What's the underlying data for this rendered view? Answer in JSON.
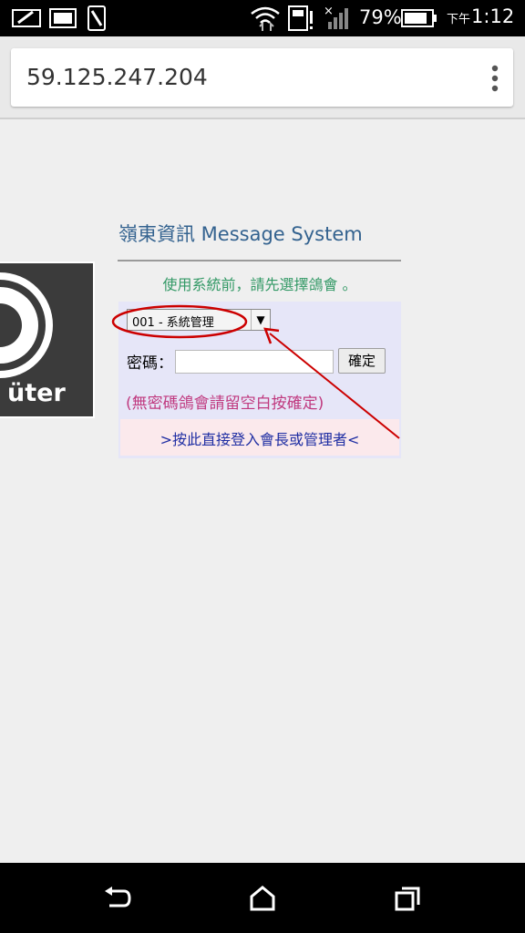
{
  "status_bar": {
    "battery_percent": "79%",
    "time_prefix": "下午",
    "time": "1:12"
  },
  "browser": {
    "url": "59.125.247.204",
    "menu_icon": "more-vert-icon"
  },
  "page": {
    "site_title": "嶺東資訊 Message System",
    "instruction": "使用系統前，請先選擇鴿會 。",
    "select": {
      "selected": "001 - 系統管理",
      "arrow": "▼"
    },
    "password_label": "密碼：",
    "password_value": "",
    "confirm_label": "確定",
    "hint": "(無密碼鴿會請留空白按確定)",
    "admin_link": ">按此直接登入會長或管理者<",
    "logo_text": "üter",
    "panel_color": "#e6e6f8",
    "link_box_color": "#fbe9ec",
    "annotation_color": "#cc0000"
  },
  "nav_bar": {
    "icons": [
      "back-icon",
      "home-icon",
      "recents-icon"
    ]
  }
}
